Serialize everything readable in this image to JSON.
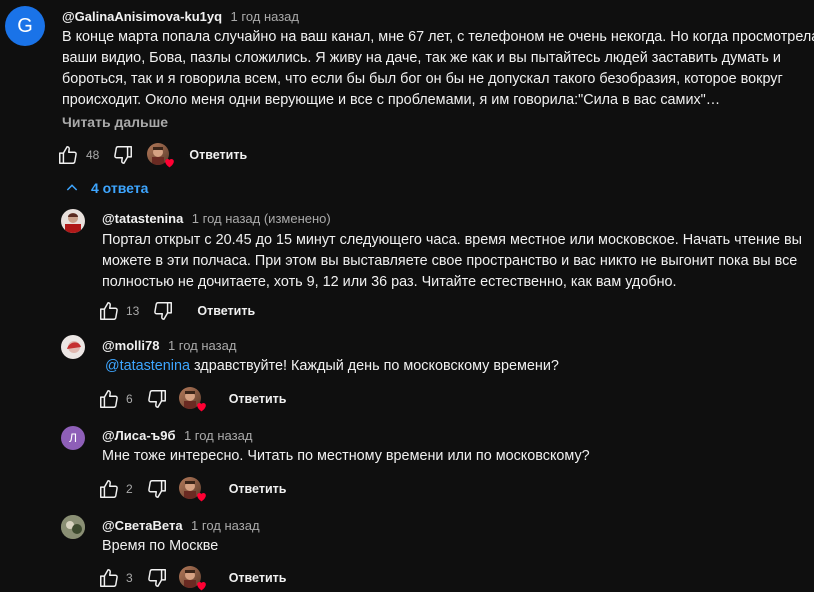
{
  "top_comment": {
    "avatar_letter": "G",
    "avatar_color": "#1a73e8",
    "author": "@GalinaAnisimova-ku1yq",
    "time": "1 год назад",
    "text_lines": [
      "В конце марта попала случайно на ваш канал, мне 67 лет, с телефоном не очень некогда. Но когда просмотрела",
      "ваши видио, Бова, пазлы сложились. Я живу на даче, так же как и вы пытайтесь людей заставить думать и",
      "бороться,  так и я говорила всем, что если бы был бог он бы не допускал такого безобразия, которое вокруг",
      "происходит. Около меня одни верующие и все с проблемами, я им говорила:\"Сила в вас самих\"…"
    ],
    "read_more": "Читать дальше",
    "likes": "48",
    "reply_label": "Ответить"
  },
  "replies_toggle": {
    "label": "4 ответа",
    "icon": "chevron-up-icon"
  },
  "replies": [
    {
      "author": "@tatastenina",
      "time": "1 год назад (изменено)",
      "avatar_icon": "user-photo",
      "text_lines": [
        "Портал открыт с 20.45 до 15 минут следующего часа. время местное или московское. Начать чтение  вы",
        "можете в эти полчаса. При этом вы выставляете свое пространство и вас никто не выгонит пока вы все",
        "полностью не дочитаете, хоть 9, 12 или 36 раз. Читайте естественно,  как вам удобно."
      ],
      "likes": "13",
      "reply_label": "Ответить",
      "creator_heart": false
    },
    {
      "author": "@molli78",
      "time": "1 год назад",
      "avatar_icon": "user-photo",
      "mention": "@tatastenina",
      "text_lines": [
        " здравствуйте! Каждый день по московскому времени?"
      ],
      "likes": "6",
      "reply_label": "Ответить",
      "creator_heart": true
    },
    {
      "author": "@Лиса-ъ9б",
      "time": "1 год назад",
      "avatar_letter": "Л",
      "avatar_color": "#8e5fb8",
      "text_lines": [
        "Мне тоже интересно.  Читать по местному времени или по московскому?"
      ],
      "likes": "2",
      "reply_label": "Ответить",
      "creator_heart": true
    },
    {
      "author": "@СветаВета",
      "time": "1 год назад",
      "avatar_icon": "user-photo",
      "text_lines": [
        "Время по Москве"
      ],
      "likes": "3",
      "reply_label": "Ответить",
      "creator_heart": true
    }
  ],
  "colors": {
    "background": "#0f0f0f",
    "text": "#f1f1f1",
    "secondary": "#aaaaaa",
    "link": "#3ea6ff",
    "heart": "#ff0033"
  }
}
